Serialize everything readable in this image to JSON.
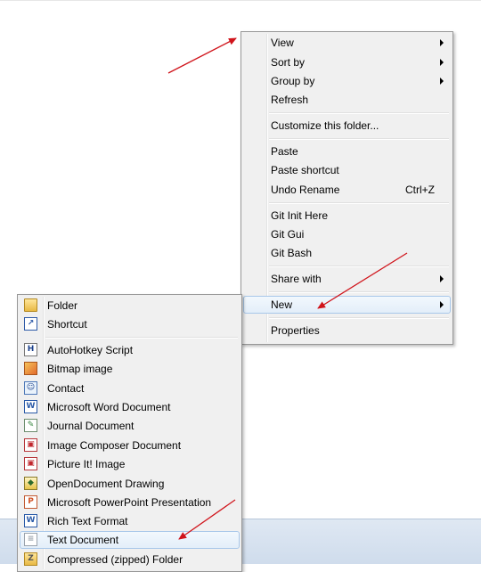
{
  "context_menu": {
    "items": [
      {
        "label": "View",
        "submenu": true
      },
      {
        "label": "Sort by",
        "submenu": true
      },
      {
        "label": "Group by",
        "submenu": true
      },
      {
        "label": "Refresh"
      },
      {
        "label": "Customize this folder..."
      },
      {
        "label": "Paste"
      },
      {
        "label": "Paste shortcut"
      },
      {
        "label": "Undo Rename",
        "shortcut": "Ctrl+Z"
      },
      {
        "label": "Git Init Here"
      },
      {
        "label": "Git Gui"
      },
      {
        "label": "Git Bash"
      },
      {
        "label": "Share with",
        "submenu": true
      },
      {
        "label": "New",
        "submenu": true,
        "highlighted": true
      },
      {
        "label": "Properties"
      }
    ]
  },
  "new_submenu": {
    "items": [
      {
        "label": "Folder",
        "icon": "folder-icon"
      },
      {
        "label": "Shortcut",
        "icon": "shortcut-icon"
      },
      {
        "label": "AutoHotkey Script",
        "icon": "autohotkey-icon",
        "glyph": "H"
      },
      {
        "label": "Bitmap image",
        "icon": "bitmap-image-icon"
      },
      {
        "label": "Contact",
        "icon": "contact-icon",
        "glyph": "☺"
      },
      {
        "label": "Microsoft Word Document",
        "icon": "word-document-icon",
        "glyph": "W"
      },
      {
        "label": "Journal Document",
        "icon": "journal-document-icon",
        "glyph": "✎"
      },
      {
        "label": "Image Composer Document",
        "icon": "image-composer-icon",
        "glyph": "▣"
      },
      {
        "label": "Picture It! Image",
        "icon": "picture-it-icon",
        "glyph": "▣"
      },
      {
        "label": "OpenDocument Drawing",
        "icon": "opendocument-drawing-icon",
        "glyph": "◆"
      },
      {
        "label": "Microsoft PowerPoint Presentation",
        "icon": "powerpoint-icon",
        "glyph": "P"
      },
      {
        "label": "Rich Text Format",
        "icon": "rich-text-icon",
        "glyph": "W"
      },
      {
        "label": "Text Document",
        "icon": "text-document-icon",
        "highlighted": true
      },
      {
        "label": "Compressed (zipped) Folder",
        "icon": "zip-folder-icon",
        "glyph": "Z"
      }
    ]
  },
  "colors": {
    "menu_bg": "#f0f0f0",
    "menu_border": "#979797",
    "highlight_border": "#a8c7e9",
    "annotation_arrow": "#d0141b",
    "taskbar": "#d6e2f0"
  }
}
